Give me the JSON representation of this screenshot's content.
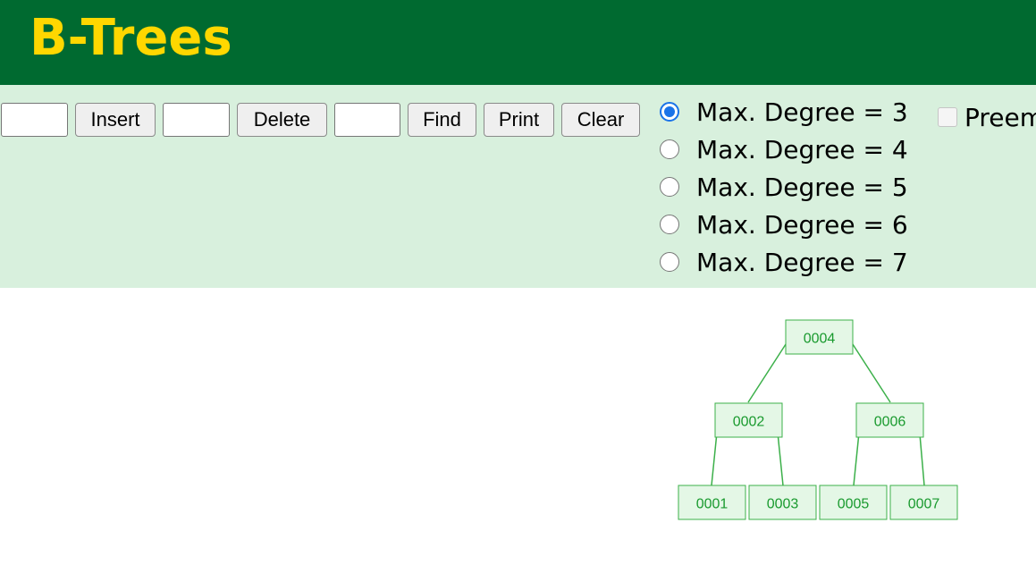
{
  "header": {
    "title": "B-Trees"
  },
  "controls": {
    "insert_label": "Insert",
    "delete_label": "Delete",
    "find_label": "Find",
    "print_label": "Print",
    "clear_label": "Clear",
    "degree_options": [
      {
        "label": "Max. Degree = 3",
        "checked": true
      },
      {
        "label": "Max. Degree = 4",
        "checked": false
      },
      {
        "label": "Max. Degree = 5",
        "checked": false
      },
      {
        "label": "Max. Degree = 6",
        "checked": false
      },
      {
        "label": "Max. Degree = 7",
        "checked": false
      }
    ],
    "preemptive_label": "Preemptive Split / Merge (Even max degree only)"
  },
  "tree": {
    "root": "0004",
    "level1": [
      "0002",
      "0006"
    ],
    "leaves": [
      "0001",
      "0003",
      "0005",
      "0007"
    ],
    "node_fill": "#e4f7e6",
    "node_stroke": "#3cb04a",
    "text_color": "#199a2e"
  }
}
